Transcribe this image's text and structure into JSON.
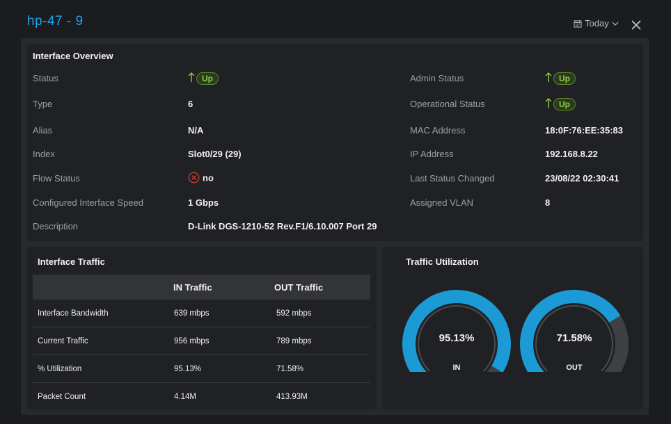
{
  "header": {
    "title": "hp-47 - 9",
    "date_range": "Today"
  },
  "overview": {
    "title": "Interface Overview",
    "status_label": "Status",
    "status_value": "Up",
    "type_label": "Type",
    "type_value": "6",
    "alias_label": "Alias",
    "alias_value": "N/A",
    "index_label": "Index",
    "index_value": "Slot0/29 (29)",
    "flow_label": "Flow Status",
    "flow_value": "no",
    "speed_label": "Configured Interface Speed",
    "speed_value": "1 Gbps",
    "desc_label": "Description",
    "desc_value": "D-Link DGS-1210-52 Rev.F1/6.10.007 Port 29",
    "admin_label": "Admin Status",
    "admin_value": "Up",
    "oper_label": "Operational Status",
    "oper_value": "Up",
    "mac_label": "MAC Address",
    "mac_value": "18:0F:76:EE:35:83",
    "ip_label": "IP Address",
    "ip_value": "192.168.8.22",
    "changed_label": "Last Status Changed",
    "changed_value": "23/08/22 02:30:41",
    "vlan_label": "Assigned VLAN",
    "vlan_value": "8"
  },
  "traffic": {
    "title": "Interface Traffic",
    "headers": [
      "",
      "IN Traffic",
      "OUT Traffic"
    ],
    "rows": [
      [
        "Interface Bandwidth",
        "639 mbps",
        "592 mbps"
      ],
      [
        "Current Traffic",
        "956 mbps",
        "789 mbps"
      ],
      [
        "% Utilization",
        "95.13%",
        "71.58%"
      ],
      [
        "Packet Count",
        "4.14M",
        "413.93M"
      ]
    ]
  },
  "utilization": {
    "title": "Traffic Utilization",
    "gauges": [
      {
        "label": "IN",
        "text": "95.13%",
        "value": 95.13
      },
      {
        "label": "OUT",
        "text": "71.58%",
        "value": 71.58
      }
    ]
  },
  "colors": {
    "accent": "#1fa4e4",
    "gauge_fill": "#1b9ad6",
    "gauge_track": "#3f4043",
    "status_up": "#8ccb3f",
    "status_error": "#e0412f"
  },
  "icons": {
    "calendar": "calendar-icon",
    "chevron": "chevron-down-icon",
    "close": "close-icon",
    "up": "arrow-up-icon",
    "error": "circle-x-icon"
  }
}
